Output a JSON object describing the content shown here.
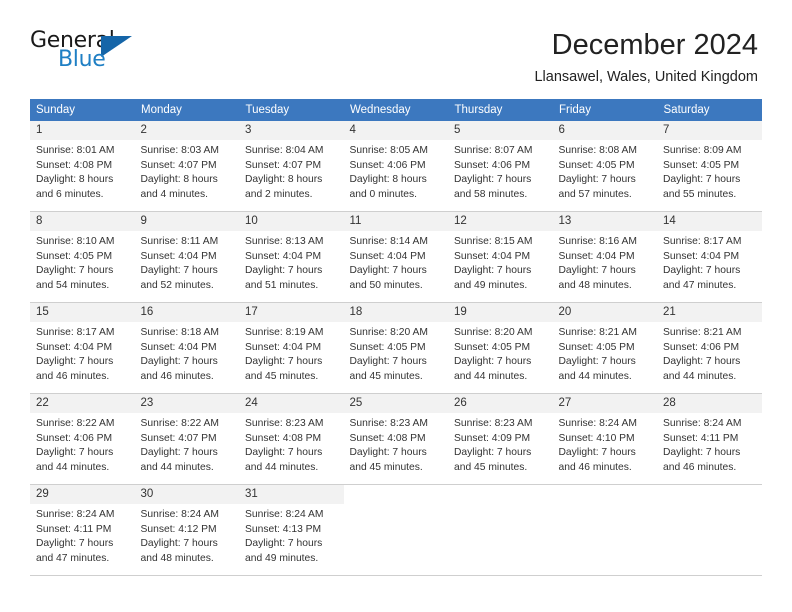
{
  "brand": {
    "name_part1": "General",
    "name_part2": "Blue",
    "triangle_icon": "triangle-logo-icon",
    "color_dark": "#1a1a1a",
    "color_blue": "#1f7fc4",
    "color_triangle": "#1565a8"
  },
  "header": {
    "title": "December 2024",
    "subtitle": "Llansawel, Wales, United Kingdom",
    "header_bg": "#3c78bf",
    "header_text_color": "#ffffff",
    "daynum_bg": "#f2f2f2"
  },
  "weekdays": [
    "Sunday",
    "Monday",
    "Tuesday",
    "Wednesday",
    "Thursday",
    "Friday",
    "Saturday"
  ],
  "weeks": [
    [
      {
        "day": "1",
        "sunrise": "Sunrise: 8:01 AM",
        "sunset": "Sunset: 4:08 PM",
        "daylight1": "Daylight: 8 hours",
        "daylight2": "and 6 minutes."
      },
      {
        "day": "2",
        "sunrise": "Sunrise: 8:03 AM",
        "sunset": "Sunset: 4:07 PM",
        "daylight1": "Daylight: 8 hours",
        "daylight2": "and 4 minutes."
      },
      {
        "day": "3",
        "sunrise": "Sunrise: 8:04 AM",
        "sunset": "Sunset: 4:07 PM",
        "daylight1": "Daylight: 8 hours",
        "daylight2": "and 2 minutes."
      },
      {
        "day": "4",
        "sunrise": "Sunrise: 8:05 AM",
        "sunset": "Sunset: 4:06 PM",
        "daylight1": "Daylight: 8 hours",
        "daylight2": "and 0 minutes."
      },
      {
        "day": "5",
        "sunrise": "Sunrise: 8:07 AM",
        "sunset": "Sunset: 4:06 PM",
        "daylight1": "Daylight: 7 hours",
        "daylight2": "and 58 minutes."
      },
      {
        "day": "6",
        "sunrise": "Sunrise: 8:08 AM",
        "sunset": "Sunset: 4:05 PM",
        "daylight1": "Daylight: 7 hours",
        "daylight2": "and 57 minutes."
      },
      {
        "day": "7",
        "sunrise": "Sunrise: 8:09 AM",
        "sunset": "Sunset: 4:05 PM",
        "daylight1": "Daylight: 7 hours",
        "daylight2": "and 55 minutes."
      }
    ],
    [
      {
        "day": "8",
        "sunrise": "Sunrise: 8:10 AM",
        "sunset": "Sunset: 4:05 PM",
        "daylight1": "Daylight: 7 hours",
        "daylight2": "and 54 minutes."
      },
      {
        "day": "9",
        "sunrise": "Sunrise: 8:11 AM",
        "sunset": "Sunset: 4:04 PM",
        "daylight1": "Daylight: 7 hours",
        "daylight2": "and 52 minutes."
      },
      {
        "day": "10",
        "sunrise": "Sunrise: 8:13 AM",
        "sunset": "Sunset: 4:04 PM",
        "daylight1": "Daylight: 7 hours",
        "daylight2": "and 51 minutes."
      },
      {
        "day": "11",
        "sunrise": "Sunrise: 8:14 AM",
        "sunset": "Sunset: 4:04 PM",
        "daylight1": "Daylight: 7 hours",
        "daylight2": "and 50 minutes."
      },
      {
        "day": "12",
        "sunrise": "Sunrise: 8:15 AM",
        "sunset": "Sunset: 4:04 PM",
        "daylight1": "Daylight: 7 hours",
        "daylight2": "and 49 minutes."
      },
      {
        "day": "13",
        "sunrise": "Sunrise: 8:16 AM",
        "sunset": "Sunset: 4:04 PM",
        "daylight1": "Daylight: 7 hours",
        "daylight2": "and 48 minutes."
      },
      {
        "day": "14",
        "sunrise": "Sunrise: 8:17 AM",
        "sunset": "Sunset: 4:04 PM",
        "daylight1": "Daylight: 7 hours",
        "daylight2": "and 47 minutes."
      }
    ],
    [
      {
        "day": "15",
        "sunrise": "Sunrise: 8:17 AM",
        "sunset": "Sunset: 4:04 PM",
        "daylight1": "Daylight: 7 hours",
        "daylight2": "and 46 minutes."
      },
      {
        "day": "16",
        "sunrise": "Sunrise: 8:18 AM",
        "sunset": "Sunset: 4:04 PM",
        "daylight1": "Daylight: 7 hours",
        "daylight2": "and 46 minutes."
      },
      {
        "day": "17",
        "sunrise": "Sunrise: 8:19 AM",
        "sunset": "Sunset: 4:04 PM",
        "daylight1": "Daylight: 7 hours",
        "daylight2": "and 45 minutes."
      },
      {
        "day": "18",
        "sunrise": "Sunrise: 8:20 AM",
        "sunset": "Sunset: 4:05 PM",
        "daylight1": "Daylight: 7 hours",
        "daylight2": "and 45 minutes."
      },
      {
        "day": "19",
        "sunrise": "Sunrise: 8:20 AM",
        "sunset": "Sunset: 4:05 PM",
        "daylight1": "Daylight: 7 hours",
        "daylight2": "and 44 minutes."
      },
      {
        "day": "20",
        "sunrise": "Sunrise: 8:21 AM",
        "sunset": "Sunset: 4:05 PM",
        "daylight1": "Daylight: 7 hours",
        "daylight2": "and 44 minutes."
      },
      {
        "day": "21",
        "sunrise": "Sunrise: 8:21 AM",
        "sunset": "Sunset: 4:06 PM",
        "daylight1": "Daylight: 7 hours",
        "daylight2": "and 44 minutes."
      }
    ],
    [
      {
        "day": "22",
        "sunrise": "Sunrise: 8:22 AM",
        "sunset": "Sunset: 4:06 PM",
        "daylight1": "Daylight: 7 hours",
        "daylight2": "and 44 minutes."
      },
      {
        "day": "23",
        "sunrise": "Sunrise: 8:22 AM",
        "sunset": "Sunset: 4:07 PM",
        "daylight1": "Daylight: 7 hours",
        "daylight2": "and 44 minutes."
      },
      {
        "day": "24",
        "sunrise": "Sunrise: 8:23 AM",
        "sunset": "Sunset: 4:08 PM",
        "daylight1": "Daylight: 7 hours",
        "daylight2": "and 44 minutes."
      },
      {
        "day": "25",
        "sunrise": "Sunrise: 8:23 AM",
        "sunset": "Sunset: 4:08 PM",
        "daylight1": "Daylight: 7 hours",
        "daylight2": "and 45 minutes."
      },
      {
        "day": "26",
        "sunrise": "Sunrise: 8:23 AM",
        "sunset": "Sunset: 4:09 PM",
        "daylight1": "Daylight: 7 hours",
        "daylight2": "and 45 minutes."
      },
      {
        "day": "27",
        "sunrise": "Sunrise: 8:24 AM",
        "sunset": "Sunset: 4:10 PM",
        "daylight1": "Daylight: 7 hours",
        "daylight2": "and 46 minutes."
      },
      {
        "day": "28",
        "sunrise": "Sunrise: 8:24 AM",
        "sunset": "Sunset: 4:11 PM",
        "daylight1": "Daylight: 7 hours",
        "daylight2": "and 46 minutes."
      }
    ],
    [
      {
        "day": "29",
        "sunrise": "Sunrise: 8:24 AM",
        "sunset": "Sunset: 4:11 PM",
        "daylight1": "Daylight: 7 hours",
        "daylight2": "and 47 minutes."
      },
      {
        "day": "30",
        "sunrise": "Sunrise: 8:24 AM",
        "sunset": "Sunset: 4:12 PM",
        "daylight1": "Daylight: 7 hours",
        "daylight2": "and 48 minutes."
      },
      {
        "day": "31",
        "sunrise": "Sunrise: 8:24 AM",
        "sunset": "Sunset: 4:13 PM",
        "daylight1": "Daylight: 7 hours",
        "daylight2": "and 49 minutes."
      },
      {
        "day": "",
        "sunrise": "",
        "sunset": "",
        "daylight1": "",
        "daylight2": ""
      },
      {
        "day": "",
        "sunrise": "",
        "sunset": "",
        "daylight1": "",
        "daylight2": ""
      },
      {
        "day": "",
        "sunrise": "",
        "sunset": "",
        "daylight1": "",
        "daylight2": ""
      },
      {
        "day": "",
        "sunrise": "",
        "sunset": "",
        "daylight1": "",
        "daylight2": ""
      }
    ]
  ]
}
